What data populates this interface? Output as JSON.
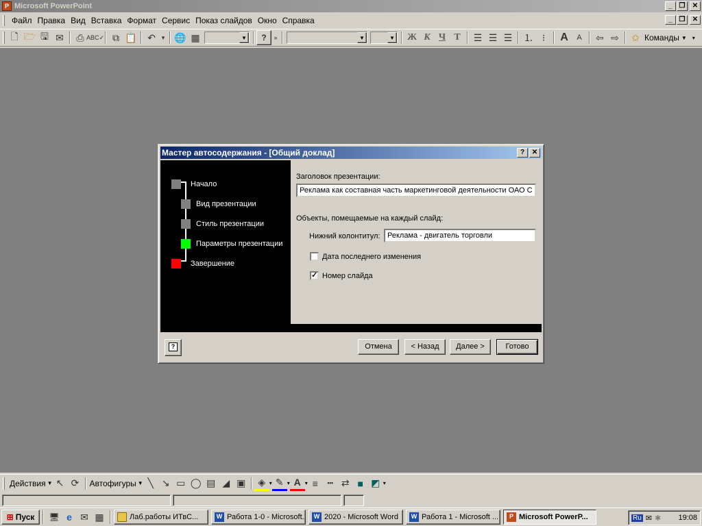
{
  "app": {
    "title": "Microsoft PowerPoint"
  },
  "menu": [
    "Файл",
    "Правка",
    "Вид",
    "Вставка",
    "Формат",
    "Сервис",
    "Показ слайдов",
    "Окно",
    "Справка"
  ],
  "toolbar": {
    "commands_label": "Команды",
    "bold": "Ж",
    "italic": "К",
    "underline": "Ч",
    "shadow": "Т"
  },
  "dialog": {
    "title": "Мастер автосодержания - [Общий доклад]",
    "steps": [
      {
        "label": "Начало",
        "color": "#808080"
      },
      {
        "label": "Вид презентации",
        "color": "#808080"
      },
      {
        "label": "Стиль презентации",
        "color": "#808080"
      },
      {
        "label": "Параметры презентации",
        "color": "#00ff00"
      },
      {
        "label": "Завершение",
        "color": "#ff0000"
      }
    ],
    "presentation_title_label": "Заголовок презентации:",
    "presentation_title_value": "Реклама как составная часть маркетинговой деятельности ОАО С",
    "objects_label": "Объекты, помещаемые на каждый слайд:",
    "footer_label": "Нижний колонтитул:",
    "footer_value": "Реклама - двигатель торговли",
    "date_checkbox_label": "Дата последнего изменения",
    "date_checked": false,
    "slide_number_label": "Номер слайда",
    "slide_number_checked": true,
    "buttons": {
      "cancel": "Отмена",
      "back": "< Назад",
      "next": "Далее >",
      "finish": "Готово"
    }
  },
  "drawing": {
    "actions": "Действия",
    "autoshapes": "Автофигуры"
  },
  "taskbar": {
    "start": "Пуск",
    "tasks": [
      {
        "label": "Лаб.работы  ИТвС...",
        "active": false
      },
      {
        "label": "Работа 1-0 - Microsoft...",
        "active": false
      },
      {
        "label": "2020 - Microsoft Word",
        "active": false
      },
      {
        "label": "Работа 1 - Microsoft ...",
        "active": false
      },
      {
        "label": "Microsoft PowerP...",
        "active": true
      }
    ],
    "lang": "Ru",
    "clock": "19:08"
  },
  "colors": {
    "workspace": "#808080",
    "dialog_title": "#0a246a"
  }
}
